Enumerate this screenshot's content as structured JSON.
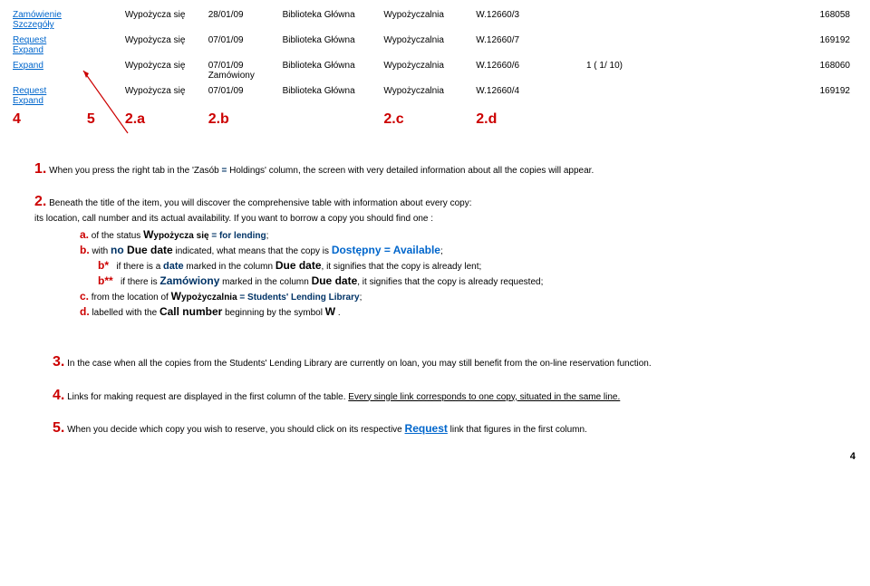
{
  "table": {
    "rows": [
      {
        "col1a": "Zamówienie",
        "col1b": "Szczegóły",
        "status": "Wypożycza się",
        "due": "28/01/09",
        "loc": "Biblioteka Główna",
        "lib": "Wypożyczalnia",
        "call": "W.12660/3",
        "extra": "",
        "id": "168058"
      },
      {
        "col1a": "Request",
        "col1b": "Expand",
        "status": "Wypożycza się",
        "due": "07/01/09",
        "loc": "Biblioteka Główna",
        "lib": "Wypożyczalnia",
        "call": "W.12660/7",
        "extra": "",
        "id": "169192"
      },
      {
        "col1a": "Expand",
        "col1b": "",
        "status": "Wypożycza się",
        "due": "07/01/09",
        "due2": "Zamówiony",
        "loc": "Biblioteka Główna",
        "lib": "Wypożyczalnia",
        "call": "W.12660/6",
        "extra": "1 ( 1/ 10)",
        "id": "168060"
      },
      {
        "col1a": "Request",
        "col1b": "Expand",
        "status": "Wypożycza się",
        "due": "07/01/09",
        "loc": "Biblioteka Główna",
        "lib": "Wypożyczalnia",
        "call": "W.12660/4",
        "extra": "",
        "id": "169192"
      }
    ],
    "labels": {
      "c4": "4",
      "c5": "5",
      "c2a": "2.a",
      "c2b": "2.b",
      "c2c": "2.c",
      "c2d": "2.d"
    }
  },
  "notes": {
    "n1_num": "1.",
    "n1": " When you press the right tab in the 'Zasób ",
    "n1_eq": "=",
    "n1b": " Holdings' column, the screen with very detailed information about all the copies will appear.",
    "n2_num": "2.",
    "n2a": " Beneath the title of the item, you will discover the comprehensive table with information about every copy:",
    "n2b": "its location, call number and its actual availability. If you want to borrow a copy you should find one :",
    "n2_a_num": "a.",
    "n2_a_1": " of the status ",
    "n2_a_2": "W",
    "n2_a_3": "ypożycza się",
    "n2_a_4": " = for lending",
    "n2_b_num": "b.",
    "n2_b_1": " with ",
    "n2_b_no": "no",
    "n2_b_2": " Due date",
    "n2_b_3": " indicated, what means that the copy is ",
    "n2_b_4": "Dostępny = Available",
    "n2_bstar": "b*",
    "n2_bstar_1": " if there is a ",
    "n2_bstar_date": "date",
    "n2_bstar_2": " marked in the column ",
    "n2_bstar_3": "Due date",
    "n2_bstar_4": ", it signifies that the copy is already lent;",
    "n2_bstarstar": "b**",
    "n2_bss_1": " if there is ",
    "n2_bss_2": "Zamówiony",
    "n2_bss_3": " marked in the column ",
    "n2_bss_4": "Due date",
    "n2_bss_5": ", it signifies that the copy is already requested;",
    "n2_c_num": "c.",
    "n2_c_1": " from the location of ",
    "n2_c_2": "W",
    "n2_c_3": "ypożyczalnia",
    "n2_c_4": " = Students' Lending Library",
    "n2_d_num": "d.",
    "n2_d_1": " labelled with the ",
    "n2_d_2": "Call number",
    "n2_d_3": " beginning by the symbol ",
    "n2_d_4": "W",
    "n3_num": "3.",
    "n3": " In the case when all the copies from the Students' Lending Library are currently on loan, you may still benefit from the on-line reservation function.",
    "n4_num": "4.",
    "n4": " Links for making request are displayed in the first column of the table. ",
    "n4b": "Every single link corresponds to one copy, situated in the same line.",
    "n5_num": "5.",
    "n5a": " When you decide which copy you wish to reserve, you should click on its respective ",
    "n5b": "Request",
    "n5c": " link that figures in the first column."
  },
  "page": "4"
}
